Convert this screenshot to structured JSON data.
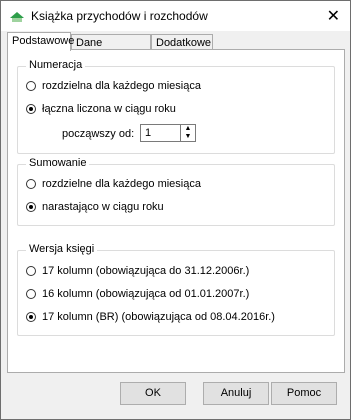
{
  "window": {
    "title": "Książka przychodów i rozchodów"
  },
  "tabs": [
    {
      "label": "Podstawowe",
      "active": true
    },
    {
      "label": "Dane domyślne",
      "active": false
    },
    {
      "label": "Dodatkowe",
      "active": false
    }
  ],
  "numeracja": {
    "legend": "Numeracja",
    "options": [
      {
        "label": "rozdzielna dla każdego miesiąca",
        "selected": false
      },
      {
        "label": "łączna liczona w ciągu roku",
        "selected": true
      }
    ],
    "start_label": "począwszy od:",
    "start_value": "1"
  },
  "sumowanie": {
    "legend": "Sumowanie",
    "options": [
      {
        "label": "rozdzielne dla każdego miesiąca",
        "selected": false
      },
      {
        "label": "narastająco w ciągu roku",
        "selected": true
      }
    ]
  },
  "wersja": {
    "legend": "Wersja księgi",
    "options": [
      {
        "label": "17 kolumn (obowiązująca do 31.12.2006r.)",
        "selected": false
      },
      {
        "label": "16 kolumn (obowiązująca od 01.01.2007r.)",
        "selected": false
      },
      {
        "label": "17 kolumn (BR) (obowiązująca od 08.04.2016r.)",
        "selected": true
      }
    ]
  },
  "buttons": {
    "ok": "OK",
    "cancel": "Anuluj",
    "help": "Pomoc"
  },
  "icons": {
    "app": "ledger-app-icon",
    "close": "close-icon"
  }
}
